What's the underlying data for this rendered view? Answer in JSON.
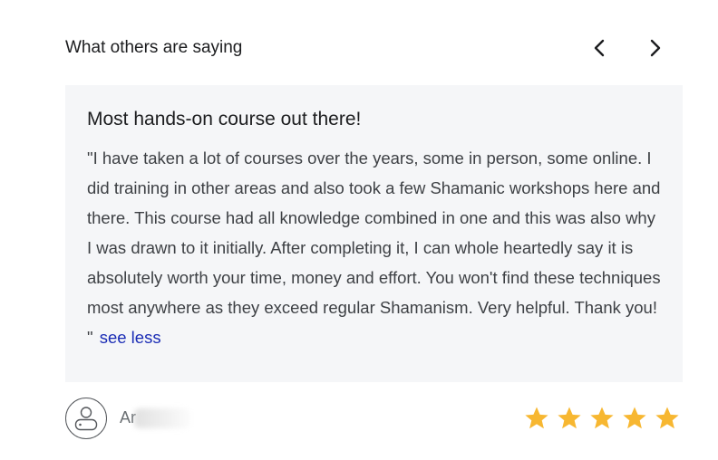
{
  "header": {
    "title": "What others are saying"
  },
  "review": {
    "title": "Most hands-on course out there!",
    "body": "\"I have taken a lot of courses over the years, some in person, some online. I did training in other areas and also took a few Shamanic workshops here and there. This course had all knowledge combined in one and this was also why I was drawn to it initially. After completing it, I can whole heartedly say it is absolutely worth your time, money and effort. You won't find these techniques most anywhere as they exceed regular Shamanism. Very helpful. Thank you! \"",
    "see_less_label": "see less",
    "author_name": "Ar",
    "rating": 5,
    "rating_max": 5
  },
  "colors": {
    "card_bg": "#f5f6f8",
    "link": "#1a2cb5",
    "star": "#f7b731"
  },
  "icons": {
    "prev": "chevron-left-icon",
    "next": "chevron-right-icon",
    "avatar": "user-avatar-icon",
    "star": "star-icon"
  }
}
